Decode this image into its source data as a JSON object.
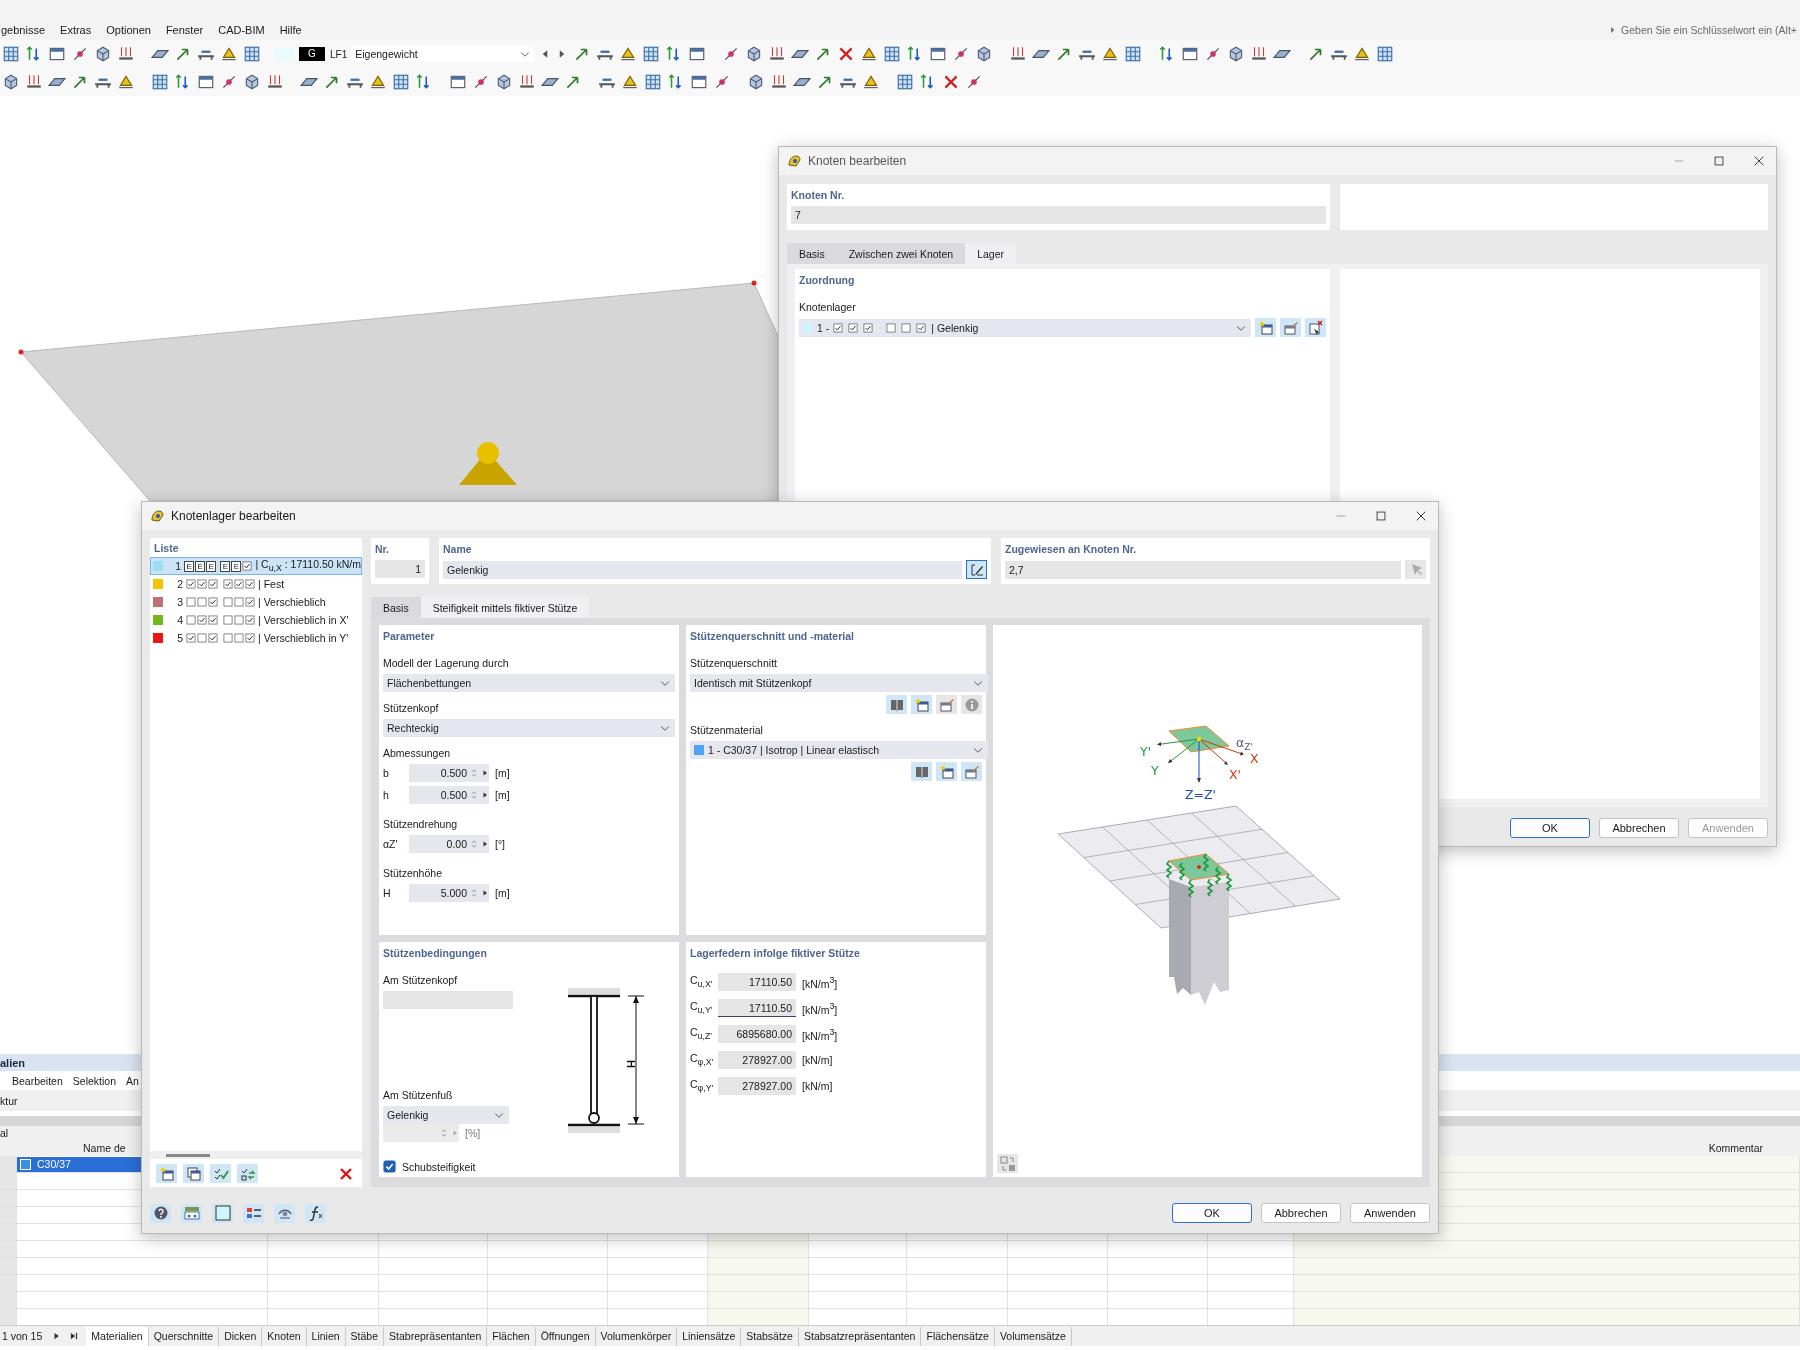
{
  "menu_bar": {
    "items": [
      "gebnisse",
      "Extras",
      "Optionen",
      "Fenster",
      "CAD-BIM",
      "Hilfe"
    ],
    "search_placeholder": "Geben Sie ein Schlüsselwort ein (Alt+"
  },
  "toolbar": {
    "color_code": "G",
    "load_case": "LF1",
    "load_case_name": "Eigengewicht"
  },
  "table_window": {
    "title": "alien",
    "menu": [
      "Bearbeiten",
      "Selektion",
      "An"
    ],
    "toolbar_label": "ktur",
    "columns": [
      "al",
      "Name de",
      "Kommentar"
    ],
    "rows": [
      {
        "name": "C30/37",
        "color": "#3d8fe0",
        "selected": true
      }
    ],
    "pager": "1 von 15",
    "sheet_tabs": [
      {
        "label": "Materialien",
        "selected": true
      },
      {
        "label": "Querschnitte",
        "selected": false
      },
      {
        "label": "Dicken",
        "selected": false
      },
      {
        "label": "Knoten",
        "selected": false
      },
      {
        "label": "Linien",
        "selected": false
      },
      {
        "label": "Stäbe",
        "selected": false
      },
      {
        "label": "Stabrepräsentanten",
        "selected": false
      },
      {
        "label": "Flächen",
        "selected": false
      },
      {
        "label": "Öffnungen",
        "selected": false
      },
      {
        "label": "Volumenkörper",
        "selected": false
      },
      {
        "label": "Liniensätze",
        "selected": false
      },
      {
        "label": "Stabsätze",
        "selected": false
      },
      {
        "label": "Stabsatzrepräsentanten",
        "selected": false
      },
      {
        "label": "Flächensätze",
        "selected": false
      },
      {
        "label": "Volumensätze",
        "selected": false
      }
    ]
  },
  "node_dialog": {
    "title": "Knoten bearbeiten",
    "node_no_label": "Knoten Nr.",
    "node_no": "7",
    "tabs": [
      {
        "label": "Basis",
        "selected": false
      },
      {
        "label": "Zwischen zwei Knoten",
        "selected": false
      },
      {
        "label": "Lager",
        "selected": true
      }
    ],
    "section_title": "Zuordnung",
    "support_label": "Knotenlager",
    "support": {
      "color": "#cdf5fb",
      "no": "1 -",
      "dofs": [
        {
          "kind": "fixed"
        },
        {
          "kind": "fixed"
        },
        {
          "kind": "fixed"
        },
        {
          "kind": "free"
        },
        {
          "kind": "free"
        },
        {
          "kind": "fixed"
        }
      ],
      "name": "| Gelenkig"
    },
    "buttons": [
      {
        "label": "OK",
        "disabled": false
      },
      {
        "label": "Abbrechen",
        "disabled": false
      },
      {
        "label": "Anwenden",
        "disabled": true
      }
    ]
  },
  "support_dialog": {
    "title": "Knotenlager bearbeiten",
    "list_title": "Liste",
    "list": [
      {
        "no": "1",
        "color": "#9ddcf5",
        "dofs": [
          {
            "kind": "elastic",
            "text": "E"
          },
          {
            "kind": "elastic",
            "text": "E"
          },
          {
            "kind": "elastic",
            "text": "E"
          },
          {
            "kind": "elastic",
            "text": "E"
          },
          {
            "kind": "elastic",
            "text": "E"
          },
          {
            "kind": "fixed"
          }
        ],
        "text": "| C$_{u,X}$ : 17110.50 kN/m",
        "selected": true
      },
      {
        "no": "2",
        "color": "#f5c400",
        "dofs": [
          {
            "kind": "fixed"
          },
          {
            "kind": "fixed"
          },
          {
            "kind": "fixed"
          },
          {
            "kind": "fixed"
          },
          {
            "kind": "fixed"
          },
          {
            "kind": "fixed"
          }
        ],
        "text": "| Fest",
        "selected": false
      },
      {
        "no": "3",
        "color": "#c0706f",
        "dofs": [
          {
            "kind": "free"
          },
          {
            "kind": "free"
          },
          {
            "kind": "fixed"
          },
          {
            "kind": "free"
          },
          {
            "kind": "free"
          },
          {
            "kind": "fixed"
          }
        ],
        "text": "| Verschieblich",
        "selected": false
      },
      {
        "no": "4",
        "color": "#74b81a",
        "dofs": [
          {
            "kind": "free"
          },
          {
            "kind": "fixed"
          },
          {
            "kind": "fixed"
          },
          {
            "kind": "free"
          },
          {
            "kind": "free"
          },
          {
            "kind": "fixed"
          }
        ],
        "text": "| Verschieblich in X'",
        "selected": false
      },
      {
        "no": "5",
        "color": "#f01414",
        "dofs": [
          {
            "kind": "fixed"
          },
          {
            "kind": "free"
          },
          {
            "kind": "fixed"
          },
          {
            "kind": "free"
          },
          {
            "kind": "free"
          },
          {
            "kind": "fixed"
          }
        ],
        "text": "| Verschieblich in Y'",
        "selected": false
      }
    ],
    "no_label": "Nr.",
    "no": "1",
    "name_label": "Name",
    "name": "Gelenkig",
    "assigned_label": "Zugewiesen an Knoten Nr.",
    "assigned": "2,7",
    "tabs": [
      {
        "label": "Basis",
        "selected": false
      },
      {
        "label": "Steifigkeit mittels fiktiver Stütze",
        "selected": true
      }
    ],
    "parameters": {
      "title": "Parameter",
      "model_label": "Modell der Lagerung durch",
      "model": "Flächenbettungen",
      "head_label": "Stützenkopf",
      "head": "Rechteckig",
      "groups": [
        {
          "label": "Abmessungen",
          "fields": [
            {
              "symbol": "b",
              "value": "0.500",
              "unit": "[m]"
            },
            {
              "symbol": "h",
              "value": "0.500",
              "unit": "[m]"
            }
          ]
        },
        {
          "label": "Stützendrehung",
          "fields": [
            {
              "symbol": "αZ'",
              "value": "0.00",
              "unit": "[°]"
            }
          ]
        },
        {
          "label": "Stützenhöhe",
          "fields": [
            {
              "symbol": "H",
              "value": "5.000",
              "unit": "[m]"
            }
          ]
        }
      ]
    },
    "section": {
      "title": "Stützenquerschnitt und -material",
      "section_label": "Stützenquerschnitt",
      "section": "Identisch mit Stützenkopf",
      "section_tools": [
        {
          "kind": "library",
          "disabled": false
        },
        {
          "kind": "new",
          "disabled": false
        },
        {
          "kind": "edit",
          "disabled": true
        },
        {
          "kind": "info",
          "disabled": true
        }
      ],
      "material_label": "Stützenmaterial",
      "material": {
        "color": "#4da3f5",
        "text": "1 - C30/37 | Isotrop | Linear elastisch"
      },
      "material_tools": [
        {
          "kind": "library",
          "disabled": false
        },
        {
          "kind": "new",
          "disabled": false
        },
        {
          "kind": "edit",
          "disabled": false
        }
      ]
    },
    "conditions": {
      "title": "Stützenbedingungen",
      "head_label": "Am Stützenkopf",
      "foot_label": "Am Stützenfuß",
      "foot": "Gelenkig",
      "percent_unit": "[%]",
      "shear": {
        "label": "Schubsteifigkeit",
        "checked": true
      },
      "height_symbol": "H"
    },
    "springs": {
      "title": "Lagerfedern infolge fiktiver Stütze",
      "rows": [
        {
          "symbol": "C$_{u,X'}$",
          "value": "17110.50",
          "unit": "[kN/m$^{3}$]"
        },
        {
          "symbol": "C$_{u,Y'}$",
          "value": "17110.50",
          "unit": "[kN/m$^{3}$]"
        },
        {
          "symbol": "C$_{u,Z'}$",
          "value": "6895680.00",
          "unit": "[kN/m$^{3}$]"
        },
        {
          "symbol": "C$_{φ,X'}$",
          "value": "278927.00",
          "unit": "[kN/m]"
        },
        {
          "symbol": "C$_{φ,Y'}$",
          "value": "278927.00",
          "unit": "[kN/m]"
        }
      ]
    },
    "figure": {
      "y_local": "Y'",
      "y": "Y",
      "z": "Z=Z'",
      "x": "X",
      "x_local": "X'",
      "angle": "α$_{Z'}$"
    },
    "buttons": [
      {
        "label": "OK",
        "disabled": false
      },
      {
        "label": "Abbrechen",
        "disabled": false
      },
      {
        "label": "Anwenden",
        "disabled": false
      }
    ]
  }
}
